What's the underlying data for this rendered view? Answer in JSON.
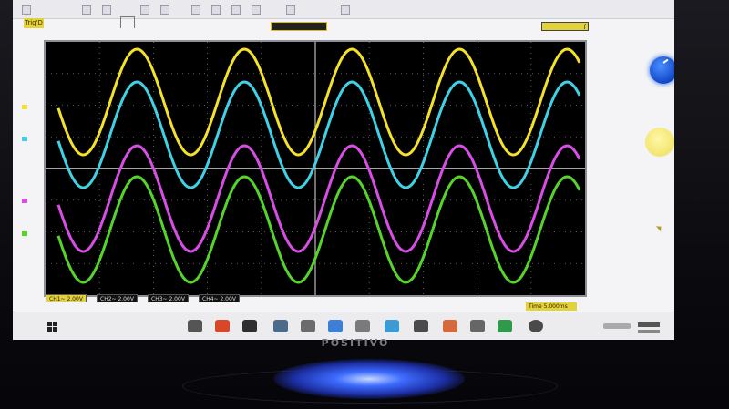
{
  "header": {
    "trig_label": "Trig'D",
    "timebase_right": "f"
  },
  "channels": [
    {
      "name": "CH1",
      "label": "CH1~ 2.00V",
      "color": "#f3e12a"
    },
    {
      "name": "CH2",
      "label": "CH2~ 2.00V",
      "color": "#3fd1e6"
    },
    {
      "name": "CH3",
      "label": "CH3~ 2.00V",
      "color": "#d64ee3"
    },
    {
      "name": "CH4",
      "label": "CH4~ 2.00V",
      "color": "#56d42a"
    }
  ],
  "footer": {
    "timebase_label": "Time 5.000ms"
  },
  "monitor": {
    "brand": "POSITIVO"
  },
  "colors": {
    "knob_blue": "#1a5cf0",
    "knob_yellow": "#f3e66e",
    "scope_bg": "#000000"
  },
  "icons": [
    "windows-start-icon",
    "search-icon",
    "edge-icon",
    "folder-icon",
    "store-icon",
    "mail-icon",
    "chat-icon",
    "app-icon",
    "app-icon",
    "chrome-icon"
  ]
}
